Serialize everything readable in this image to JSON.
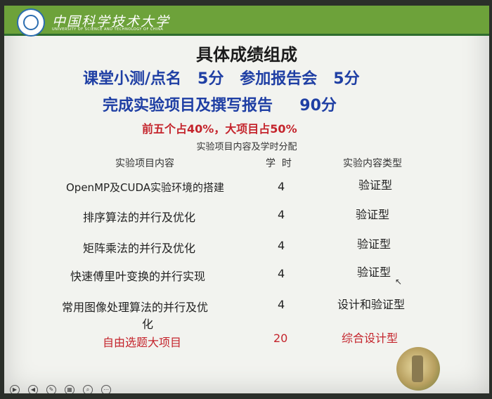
{
  "header": {
    "university_cn": "中国科学技术大学",
    "university_en": "UNIVERSITY OF SCIENCE AND TECHNOLOGY OF CHINA"
  },
  "content": {
    "title": "具体成绩组成",
    "line1": "课堂小测/点名   5分   参加报告会   5分",
    "line2": "完成实验项目及撰写报告     90分",
    "line3": "前五个占40%，大项目占50%",
    "table_caption": "实验项目内容及学时分配"
  },
  "table": {
    "headers": [
      "实验项目内容",
      "学  时",
      "实验内容类型"
    ],
    "rows": [
      {
        "item": "OpenMP及CUDA实验环境的搭建",
        "hours": "4",
        "type": "验证型"
      },
      {
        "item": "排序算法的并行及优化",
        "hours": "4",
        "type": "验证型"
      },
      {
        "item": "矩阵乘法的并行及优化",
        "hours": "4",
        "type": "验证型"
      },
      {
        "item": "快速傅里叶变换的并行实现",
        "hours": "4",
        "type": "验证型"
      },
      {
        "item": "常用图像处理算法的并行及优",
        "item2": "化",
        "hours": "4",
        "type": "设计和验证型"
      },
      {
        "item": "自由选题大项目",
        "hours": "20",
        "type": "综合设计型"
      }
    ]
  },
  "colors": {
    "header_green": "#6da23a",
    "title_blue": "#1f3fa4",
    "highlight_red": "#c4242c"
  },
  "footer_icons": [
    "play-icon",
    "back-icon",
    "pen-icon",
    "slides-icon",
    "zoom-icon",
    "more-icon"
  ]
}
